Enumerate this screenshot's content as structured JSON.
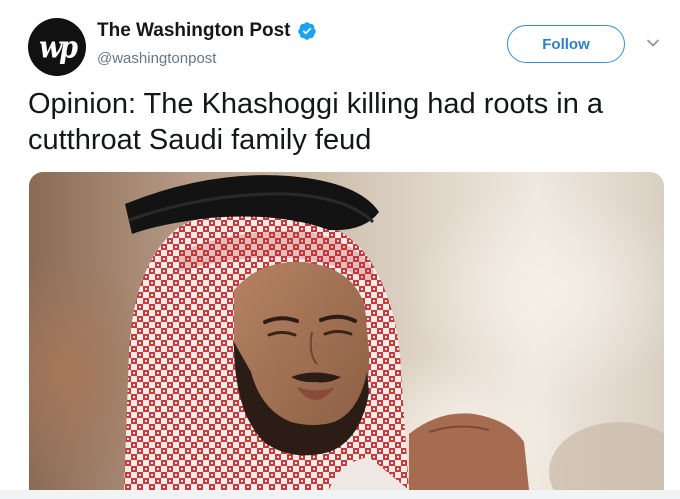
{
  "account": {
    "display_name": "The Washington Post",
    "handle": "@washingtonpost",
    "avatar_text": "wp",
    "verified": true
  },
  "actions": {
    "follow_label": "Follow"
  },
  "tweet": {
    "text_line1": "Opinion: The Khashoggi killing had roots in a",
    "text_line2": "cutthroat Saudi family feud"
  },
  "icons": {
    "avatar": "washington-post-logo",
    "verified": "verified-badge-icon",
    "more": "chevron-down-icon"
  },
  "colors": {
    "accent": "#1da1f2",
    "follow_text": "#2e7fc4",
    "handle": "#657786",
    "text": "#14171a"
  }
}
